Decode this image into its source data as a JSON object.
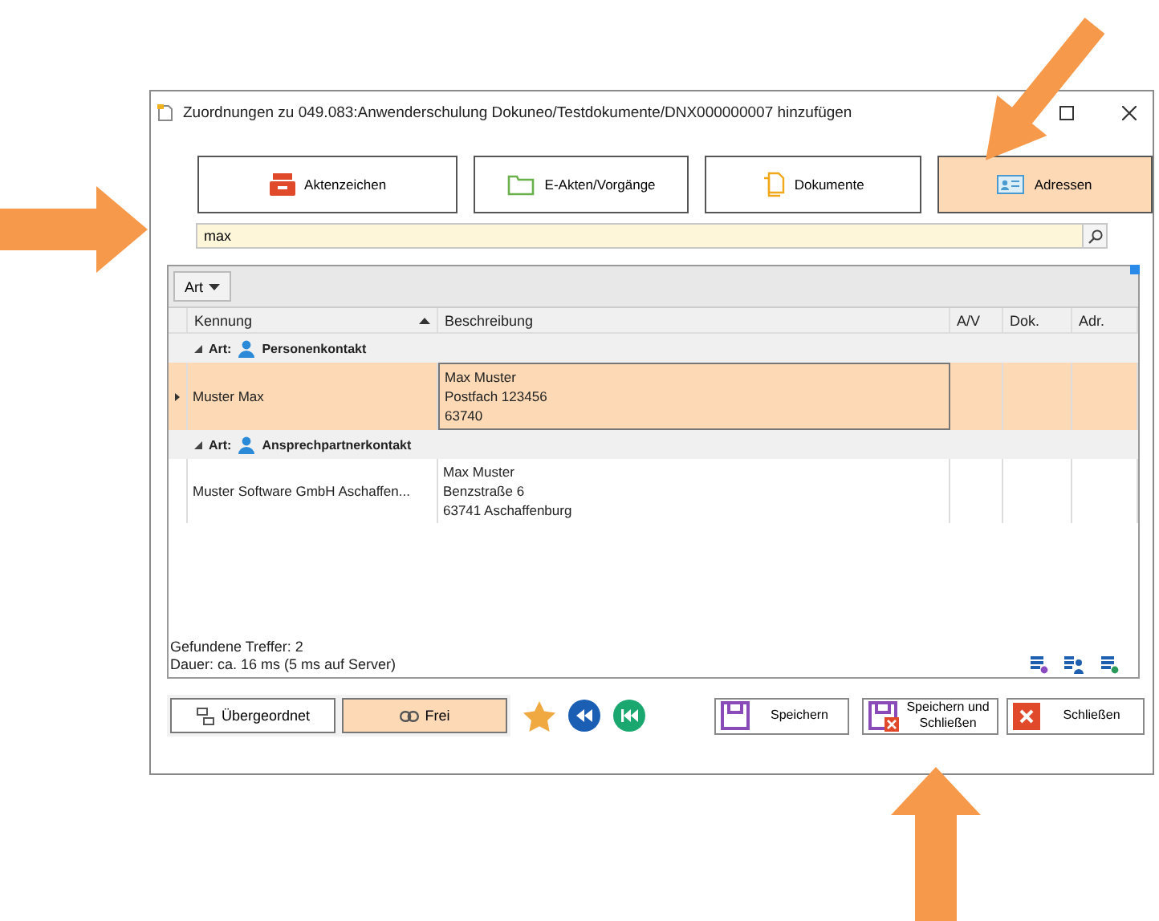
{
  "window": {
    "title": "Zuordnungen zu 049.083:Anwenderschulung Dokuneo/Testdokumente/DNX000000007 hinzufügen"
  },
  "categories": [
    {
      "label": "Aktenzeichen",
      "selected": false
    },
    {
      "label": "E-Akten/Vorgänge",
      "selected": false
    },
    {
      "label": "Dokumente",
      "selected": false
    },
    {
      "label": "Adressen",
      "selected": true
    }
  ],
  "search": {
    "value": "max"
  },
  "grid": {
    "group_button": "Art",
    "columns": [
      {
        "label": "Kennung",
        "sorted": true
      },
      {
        "label": "Beschreibung",
        "sorted": false
      },
      {
        "label": "A/V",
        "sorted": false
      },
      {
        "label": "Dok.",
        "sorted": false
      },
      {
        "label": "Adr.",
        "sorted": false
      }
    ],
    "groups": [
      {
        "label": "Art:",
        "value": "Personenkontakt",
        "expanded": true,
        "rows": [
          {
            "kennung": "Muster Max",
            "beschreibung": [
              "Max Muster",
              "Postfach 123456",
              "63740"
            ],
            "selected": true
          }
        ]
      },
      {
        "label": "Art:",
        "value": "Ansprechpartnerkontakt",
        "expanded": true,
        "rows": [
          {
            "kennung": "Muster Software GmbH Aschaffen...",
            "beschreibung": [
              "Max Muster",
              "Benzstraße 6",
              "63741 Aschaffenburg"
            ],
            "selected": false
          }
        ]
      }
    ]
  },
  "status": {
    "found": "Gefundene Treffer: 2",
    "duration": "Dauer: ca. 16 ms (5 ms auf Server)"
  },
  "filter_buttons": [
    {
      "label": "Übergeordnet",
      "selected": false
    },
    {
      "label": "Frei",
      "selected": true
    }
  ],
  "actions": [
    {
      "label": "Speichern"
    },
    {
      "label": "Speichern und Schließen"
    },
    {
      "label": "Schließen"
    }
  ]
}
